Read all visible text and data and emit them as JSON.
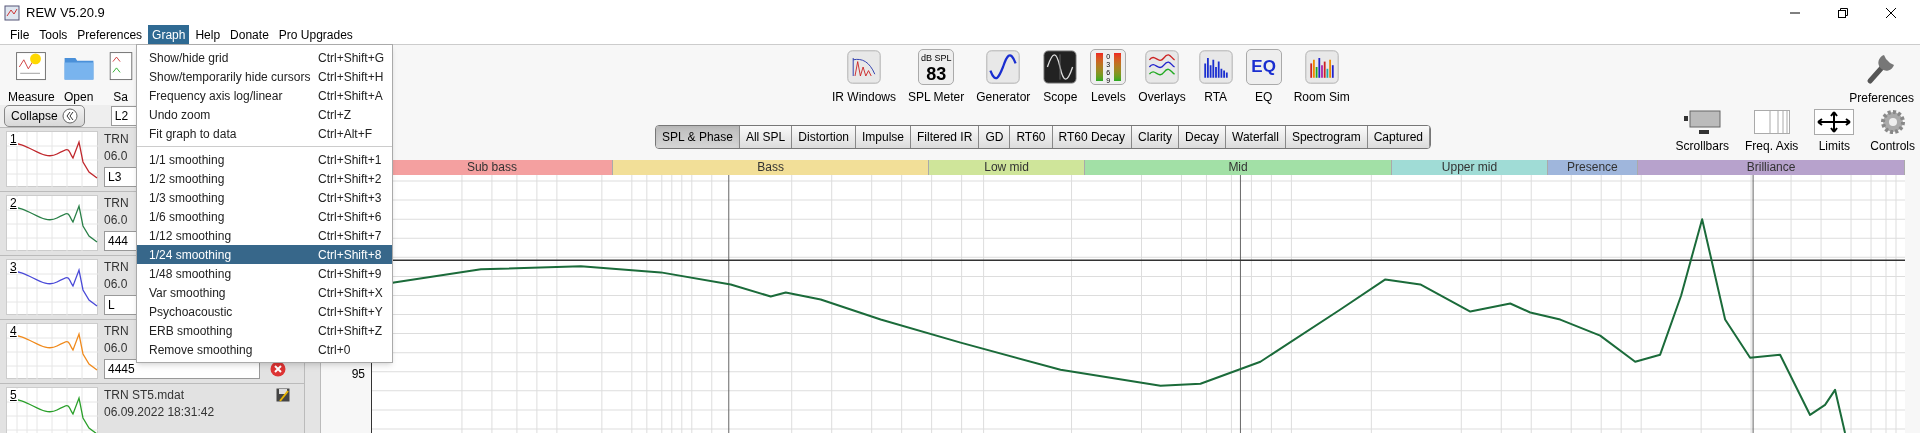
{
  "window": {
    "title": "REW V5.20.9"
  },
  "menu": [
    {
      "label": "File",
      "selected": false
    },
    {
      "label": "Tools",
      "selected": false
    },
    {
      "label": "Preferences",
      "selected": false
    },
    {
      "label": "Graph",
      "selected": true
    },
    {
      "label": "Help",
      "selected": false
    },
    {
      "label": "Donate",
      "selected": false
    },
    {
      "label": "Pro Upgrades",
      "selected": false
    }
  ],
  "toolbar_left": [
    {
      "kind": "measure",
      "label": "Measure"
    },
    {
      "kind": "open",
      "label": "Open"
    },
    {
      "kind": "save",
      "label": "Sa"
    }
  ],
  "toolbar_center": [
    {
      "kind": "ir",
      "label": "IR Windows"
    },
    {
      "kind": "spl",
      "label": "SPL Meter",
      "top": "dB SPL",
      "value": "83"
    },
    {
      "kind": "generator",
      "label": "Generator"
    },
    {
      "kind": "scope",
      "label": "Scope"
    },
    {
      "kind": "levels",
      "label": "Levels",
      "digits": "0369"
    },
    {
      "kind": "overlays",
      "label": "Overlays"
    },
    {
      "kind": "rta",
      "label": "RTA"
    },
    {
      "kind": "eq",
      "label": "EQ",
      "glyph": "EQ"
    },
    {
      "kind": "roomsim",
      "label": "Room Sim"
    }
  ],
  "toolbar_right": {
    "label": "Preferences"
  },
  "collapse_button": {
    "label": "Collapse"
  },
  "top_note": "L2",
  "measurements": [
    {
      "number": "1",
      "color": "#c0282d",
      "name": "TRN",
      "date": "06.0",
      "note": "L3"
    },
    {
      "number": "2",
      "color": "#2a8048",
      "name": "TRN",
      "date": "06.0",
      "note": "444"
    },
    {
      "number": "3",
      "color": "#4a4ad8",
      "name": "TRN",
      "date": "06.0",
      "note": "L"
    },
    {
      "number": "4",
      "color": "#f08a1c",
      "name": "TRN",
      "date": "06.0",
      "note": "4445"
    },
    {
      "number": "5",
      "color": "#2aa02a",
      "name": "TRN ST5.mdat",
      "date": "06.09.2022 18:31:42"
    }
  ],
  "graph_menu": {
    "groups": [
      [
        {
          "label": "Show/hide grid",
          "shortcut": "Ctrl+Shift+G",
          "selected": false
        },
        {
          "label": "Show/temporarily hide cursors",
          "shortcut": "Ctrl+Shift+H",
          "selected": false
        },
        {
          "label": "Frequency axis log/linear",
          "shortcut": "Ctrl+Shift+A",
          "selected": false
        },
        {
          "label": "Undo zoom",
          "shortcut": "Ctrl+Z",
          "selected": false
        },
        {
          "label": "Fit graph to data",
          "shortcut": "Ctrl+Alt+F",
          "selected": false
        }
      ],
      [
        {
          "label": "1/1 smoothing",
          "shortcut": "Ctrl+Shift+1",
          "selected": false
        },
        {
          "label": "1/2 smoothing",
          "shortcut": "Ctrl+Shift+2",
          "selected": false
        },
        {
          "label": "1/3 smoothing",
          "shortcut": "Ctrl+Shift+3",
          "selected": false
        },
        {
          "label": "1/6 smoothing",
          "shortcut": "Ctrl+Shift+6",
          "selected": false
        },
        {
          "label": "1/12 smoothing",
          "shortcut": "Ctrl+Shift+7",
          "selected": false
        },
        {
          "label": "1/24 smoothing",
          "shortcut": "Ctrl+Shift+8",
          "selected": true
        },
        {
          "label": "1/48 smoothing",
          "shortcut": "Ctrl+Shift+9",
          "selected": false
        },
        {
          "label": "Var smoothing",
          "shortcut": "Ctrl+Shift+X",
          "selected": false
        },
        {
          "label": "Psychoacoustic",
          "shortcut": "Ctrl+Shift+Y",
          "selected": false
        },
        {
          "label": "ERB smoothing",
          "shortcut": "Ctrl+Shift+Z",
          "selected": false
        },
        {
          "label": "Remove smoothing",
          "shortcut": "Ctrl+0",
          "selected": false
        }
      ]
    ]
  },
  "graph_tabs": [
    {
      "label": "SPL & Phase",
      "selected": true
    },
    {
      "label": "All SPL",
      "selected": false
    },
    {
      "label": "Distortion",
      "selected": false
    },
    {
      "label": "Impulse",
      "selected": false
    },
    {
      "label": "Filtered IR",
      "selected": false
    },
    {
      "label": "GD",
      "selected": false
    },
    {
      "label": "RT60",
      "selected": false
    },
    {
      "label": "RT60 Decay",
      "selected": false
    },
    {
      "label": "Clarity",
      "selected": false
    },
    {
      "label": "Decay",
      "selected": false
    },
    {
      "label": "Waterfall",
      "selected": false
    },
    {
      "label": "Spectrogram",
      "selected": false
    },
    {
      "label": "Captured",
      "selected": false
    }
  ],
  "graph_controls": [
    {
      "kind": "scrollbars",
      "label": "Scrollbars"
    },
    {
      "kind": "freqaxis",
      "label": "Freq. Axis"
    },
    {
      "kind": "limits",
      "label": "Limits"
    },
    {
      "kind": "controls",
      "label": "Controls"
    }
  ],
  "bands": [
    {
      "label": "Sub bass",
      "color": "#f4a0a0"
    },
    {
      "label": "Bass",
      "color": "#f2df98"
    },
    {
      "label": "Low mid",
      "color": "#cfe59a"
    },
    {
      "label": "Mid",
      "color": "#a2e0a6"
    },
    {
      "label": "Upper mid",
      "color": "#a0dcd6"
    },
    {
      "label": "Presence",
      "color": "#9fb6dc"
    },
    {
      "label": "Brilliance",
      "color": "#b7a2cc"
    }
  ],
  "y_axis_labels": [
    "95"
  ]
}
